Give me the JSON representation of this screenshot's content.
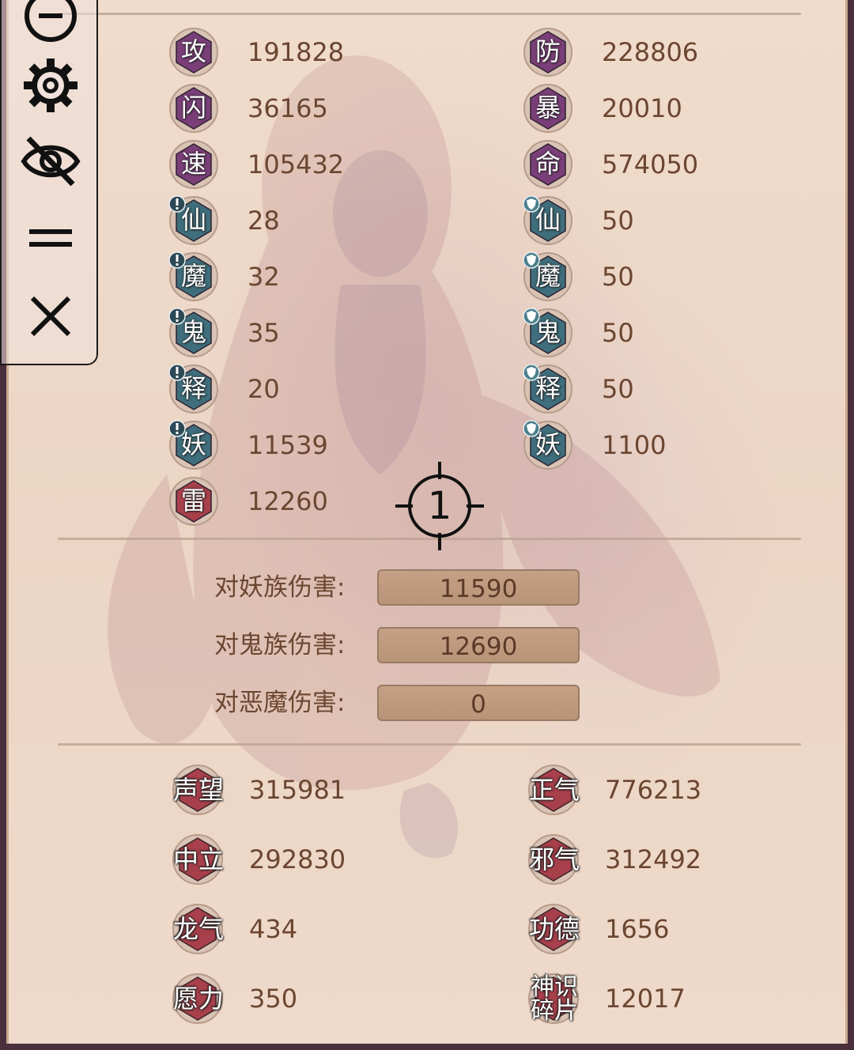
{
  "combat_stats": {
    "left": [
      {
        "char": "攻",
        "value": "191828",
        "style": "purple",
        "badge": null
      },
      {
        "char": "闪",
        "value": "36165",
        "style": "purple",
        "badge": null
      },
      {
        "char": "速",
        "value": "105432",
        "style": "purple",
        "badge": null
      },
      {
        "char": "仙",
        "value": "28",
        "style": "teal",
        "badge": "alert"
      },
      {
        "char": "魔",
        "value": "32",
        "style": "teal",
        "badge": "alert"
      },
      {
        "char": "鬼",
        "value": "35",
        "style": "teal",
        "badge": "alert"
      },
      {
        "char": "释",
        "value": "20",
        "style": "teal",
        "badge": "alert"
      },
      {
        "char": "妖",
        "value": "11539",
        "style": "teal",
        "badge": "alert"
      },
      {
        "char": "雷",
        "value": "12260",
        "style": "red",
        "badge": null
      }
    ],
    "right": [
      {
        "char": "防",
        "value": "228806",
        "style": "purple",
        "badge": null
      },
      {
        "char": "暴",
        "value": "20010",
        "style": "purple",
        "badge": null
      },
      {
        "char": "命",
        "value": "574050",
        "style": "purple",
        "badge": null
      },
      {
        "char": "仙",
        "value": "50",
        "style": "teal",
        "badge": "shield"
      },
      {
        "char": "魔",
        "value": "50",
        "style": "teal",
        "badge": "shield"
      },
      {
        "char": "鬼",
        "value": "50",
        "style": "teal",
        "badge": "shield"
      },
      {
        "char": "释",
        "value": "50",
        "style": "teal",
        "badge": "shield"
      },
      {
        "char": "妖",
        "value": "1100",
        "style": "teal",
        "badge": "shield"
      }
    ]
  },
  "damage_bonus": [
    {
      "label": "对妖族伤害:",
      "value": "11590"
    },
    {
      "label": "对鬼族伤害:",
      "value": "12690"
    },
    {
      "label": "对恶魔伤害:",
      "value": "0"
    }
  ],
  "attributes": {
    "left": [
      {
        "name": "声望",
        "value": "315981"
      },
      {
        "name": "中立",
        "value": "292830"
      },
      {
        "name": "龙气",
        "value": "434"
      },
      {
        "name": "愿力",
        "value": "350"
      }
    ],
    "right": [
      {
        "name": "正气",
        "value": "776213"
      },
      {
        "name": "邪气",
        "value": "312492"
      },
      {
        "name": "功德",
        "value": "1656"
      },
      {
        "name": "神识碎片",
        "value": "12017"
      }
    ]
  },
  "toolbar": {
    "buttons": [
      "minimize-icon",
      "gear-icon",
      "eye-off-icon",
      "menu-icon",
      "close-icon"
    ]
  },
  "crosshair": {
    "label": "1"
  },
  "colors": {
    "purple_hex": "#7a3f78",
    "teal_hex": "#3f6e7c",
    "red_hex": "#a8404c",
    "text": "#6b4630",
    "panel_bg": "#f0dccc"
  }
}
